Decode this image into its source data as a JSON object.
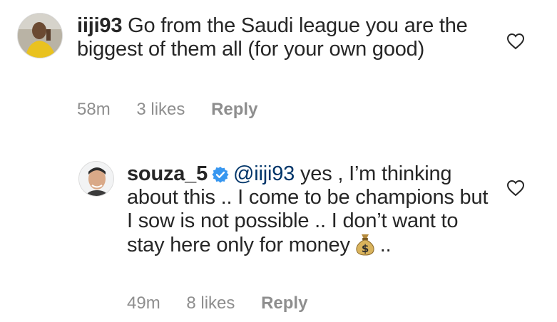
{
  "comments": [
    {
      "username": "iiji93",
      "mention": "",
      "text": "Go from the Saudi league you are the biggest of them all (for your own good)",
      "time": "58m",
      "likes": "3 likes",
      "reply_label": "Reply",
      "verified": false
    },
    {
      "username": "souza_5",
      "mention": "@iiji93",
      "text": "yes , I’m thinking about this .. I come to be champions but I sow is not possible .. I don’t want to stay here only for money",
      "text_after_emoji": "..",
      "emoji": "money-bag-icon",
      "time": "49m",
      "likes": "8 likes",
      "reply_label": "Reply",
      "verified": true
    }
  ],
  "colors": {
    "text": "#262626",
    "meta": "#8e8e8e",
    "mention": "#003569",
    "verified": "#3897f0"
  }
}
